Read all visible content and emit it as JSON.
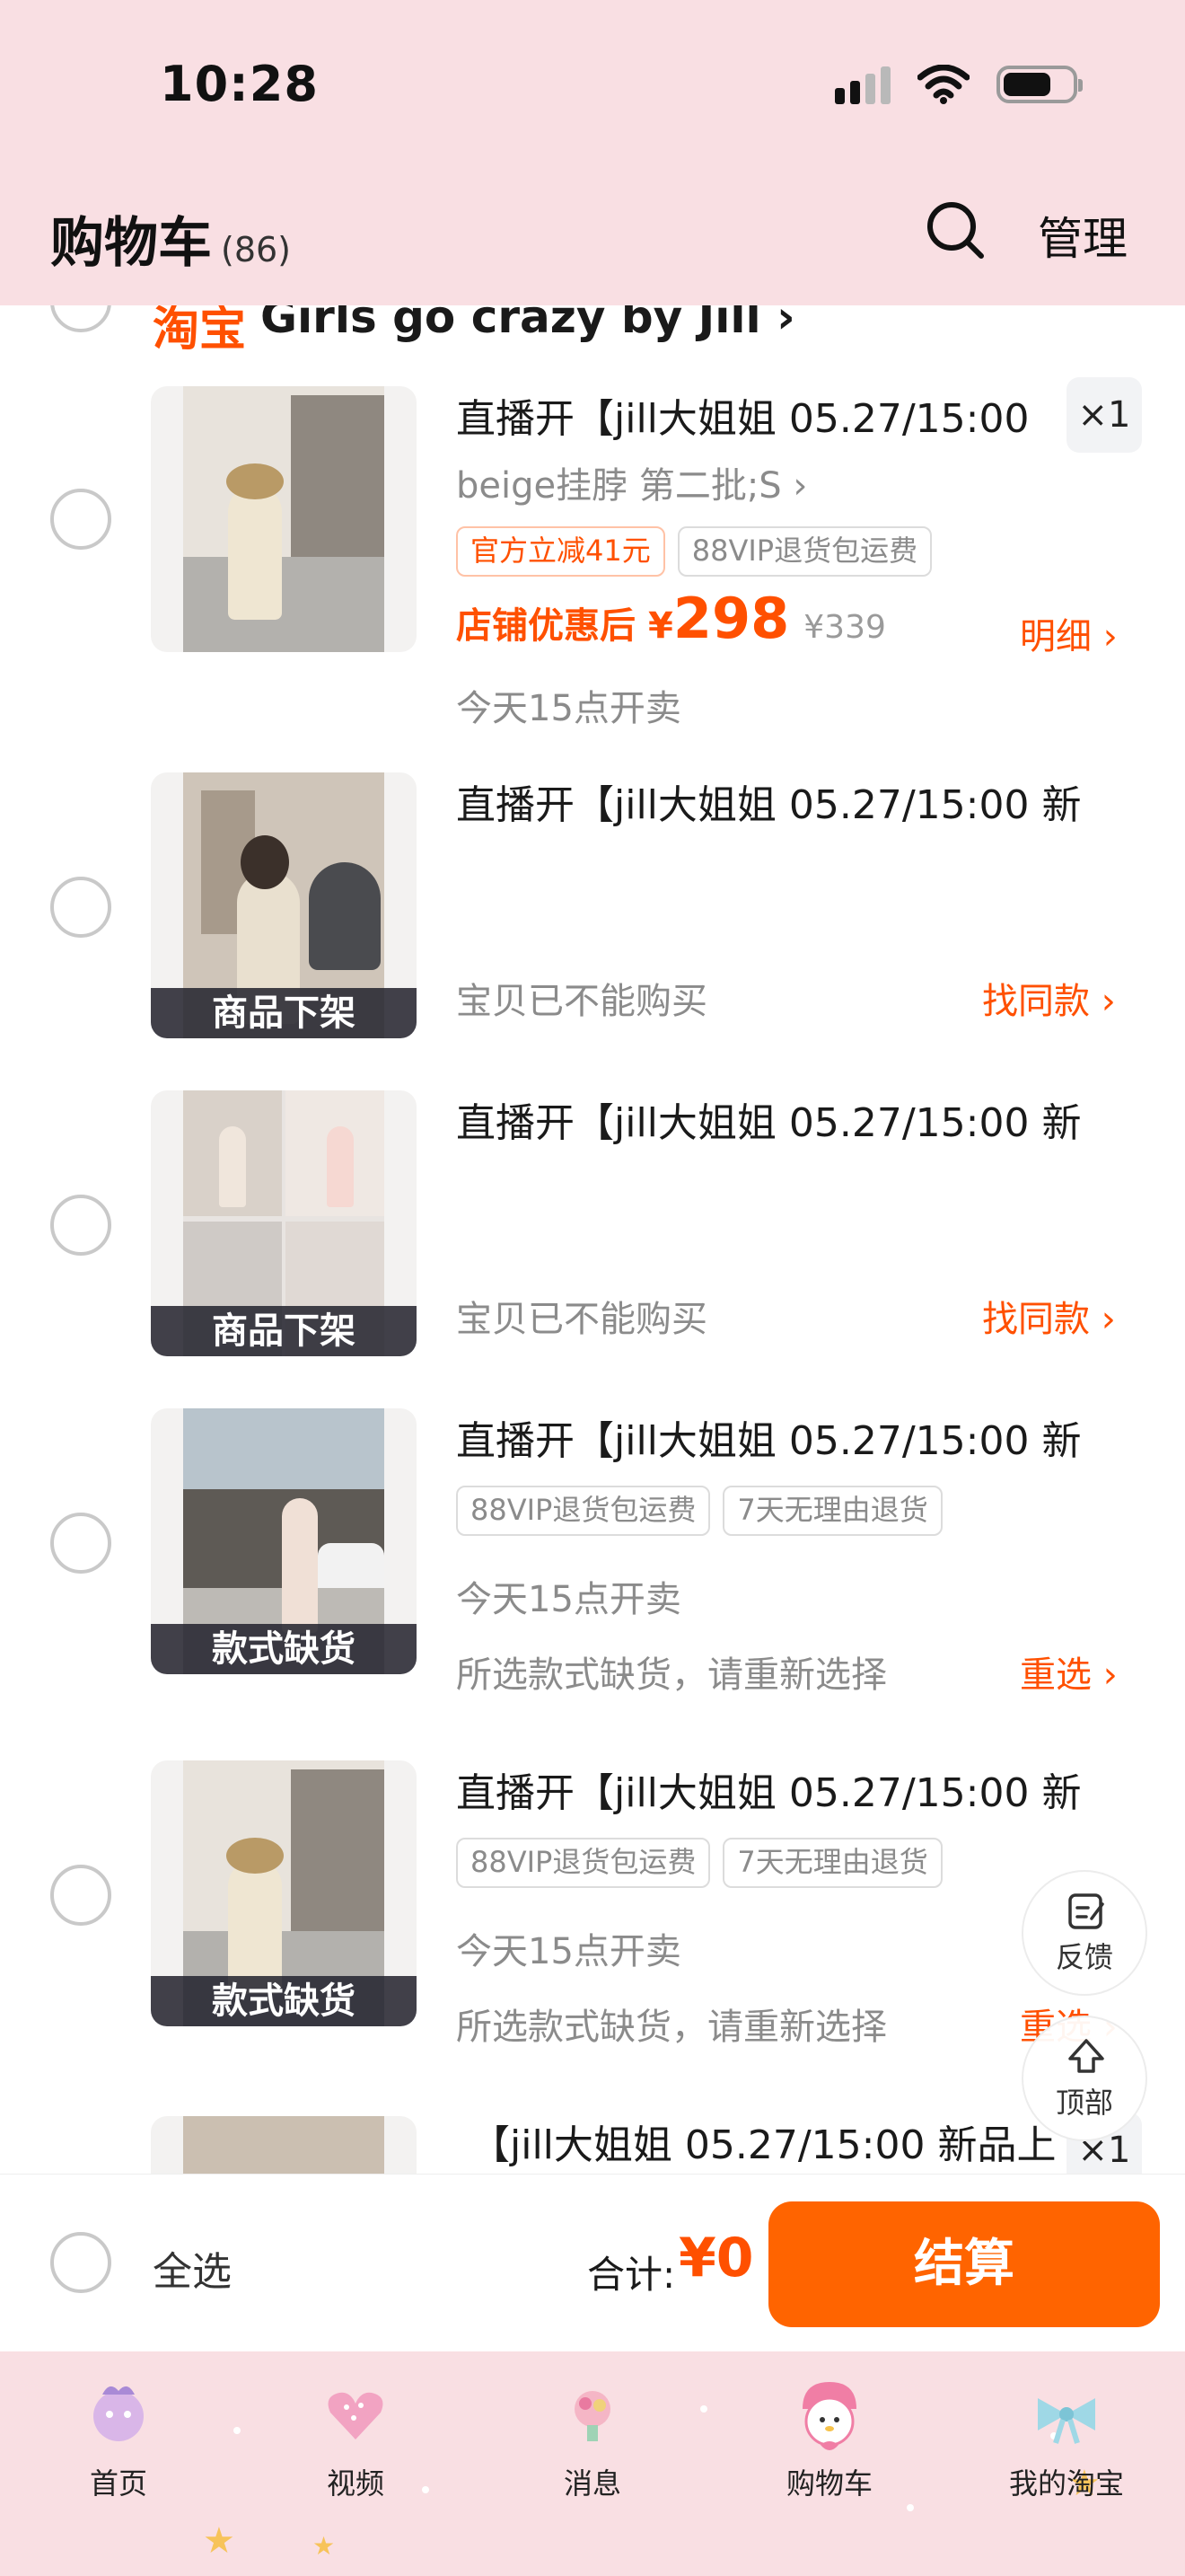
{
  "status_bar": {
    "time": "10:28"
  },
  "header": {
    "title": "购物车",
    "count": "(86)",
    "manage_label": "管理",
    "search_icon": "search-icon"
  },
  "store": {
    "logo": "淘宝",
    "name": "Girls go crazy by Jill",
    "chevron": "›"
  },
  "items": [
    {
      "title": "直播开【jill大姐姐 05.27/15:00",
      "sku": "beige挂脖 第二批;S",
      "sku_chevron": "›",
      "tags": [
        "官方立减41元",
        "88VIP退货包运费"
      ],
      "price_label": "店铺优惠后",
      "price_symbol": "¥",
      "price": "298",
      "original_price": "¥339",
      "detail_link": "明细 ›",
      "sale_note": "今天15点开卖",
      "qty": "×1"
    },
    {
      "title": "直播开【jill大姐姐 05.27/15:00 新",
      "overlay": "商品下架",
      "status": "宝贝已不能购买",
      "link": "找同款 ›"
    },
    {
      "title": "直播开【jill大姐姐 05.27/15:00 新",
      "overlay": "商品下架",
      "status": "宝贝已不能购买",
      "link": "找同款 ›"
    },
    {
      "title": "直播开【jill大姐姐 05.27/15:00 新",
      "overlay": "款式缺货",
      "tags": [
        "88VIP退货包运费",
        "7天无理由退货"
      ],
      "sale_note": "今天15点开卖",
      "status": "所选款式缺货，请重新选择",
      "link": "重选 ›"
    },
    {
      "title": "直播开【jill大姐姐 05.27/15:00 新",
      "overlay": "款式缺货",
      "tags": [
        "88VIP退货包运费",
        "7天无理由退货"
      ],
      "sale_note": "今天15点开卖",
      "status": "所选款式缺货，请重新选择",
      "link": "重选 ›"
    },
    {
      "title": "【jill大姐姐 05.27/15:00 新品上",
      "qty": "×1"
    }
  ],
  "floating": {
    "feedback": "反馈",
    "top": "顶部"
  },
  "checkout": {
    "select_all": "全选",
    "total_label": "合计:",
    "total_value": "¥0",
    "button": "结算"
  },
  "tabbar": [
    {
      "label": "首页",
      "icon": "home-icon"
    },
    {
      "label": "视频",
      "icon": "video-icon"
    },
    {
      "label": "消息",
      "icon": "message-icon"
    },
    {
      "label": "购物车",
      "icon": "cart-icon"
    },
    {
      "label": "我的淘宝",
      "icon": "my-taobao-icon"
    }
  ],
  "colors": {
    "accent": "#ff5000",
    "header_bg": "#f9dfe3",
    "checkout_btn": "#ff6400"
  }
}
